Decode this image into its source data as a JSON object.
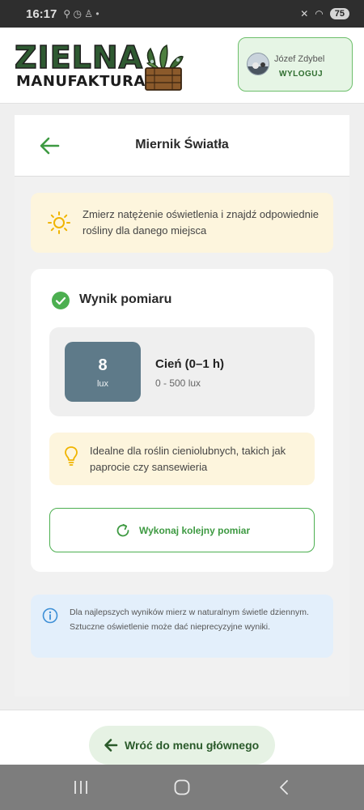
{
  "status_bar": {
    "time": "16:17",
    "battery": "75"
  },
  "header": {
    "logo_line1": "ZIELNA",
    "logo_line2": "MANUFAKTURA",
    "user_name": "Józef Zdybel",
    "logout_label": "WYLOGUJ"
  },
  "page": {
    "title": "Miernik Światła"
  },
  "hint": {
    "text": "Zmierz natężenie oświetlenia i znajdź odpowiednie rośliny dla danego miejsca"
  },
  "result": {
    "title": "Wynik pomiaru",
    "value": "8",
    "unit": "lux",
    "category": "Cień (0–1 h)",
    "range": "0 - 500 lux",
    "tip": "Idealne dla roślin cieniolubnych, takich jak paprocie czy sansewieria",
    "remeasure_label": "Wykonaj kolejny pomiar"
  },
  "info": {
    "text": "Dla najlepszych wyników mierz w naturalnym świetle dziennym. Sztuczne oświetlenie może dać nieprecyzyjne wyniki."
  },
  "bottom": {
    "main_menu_label": "Wróć do menu głównego"
  },
  "icons": [
    "arrow-left-icon",
    "sun-icon",
    "check-circle-icon",
    "lightbulb-icon",
    "refresh-icon",
    "info-icon",
    "recent-apps-icon",
    "home-icon",
    "back-icon"
  ],
  "colors": {
    "accent_green": "#4caf50",
    "lux_tile": "#5e7a89",
    "hint_bg": "#fdf5dd",
    "info_bg": "#e3effb"
  }
}
